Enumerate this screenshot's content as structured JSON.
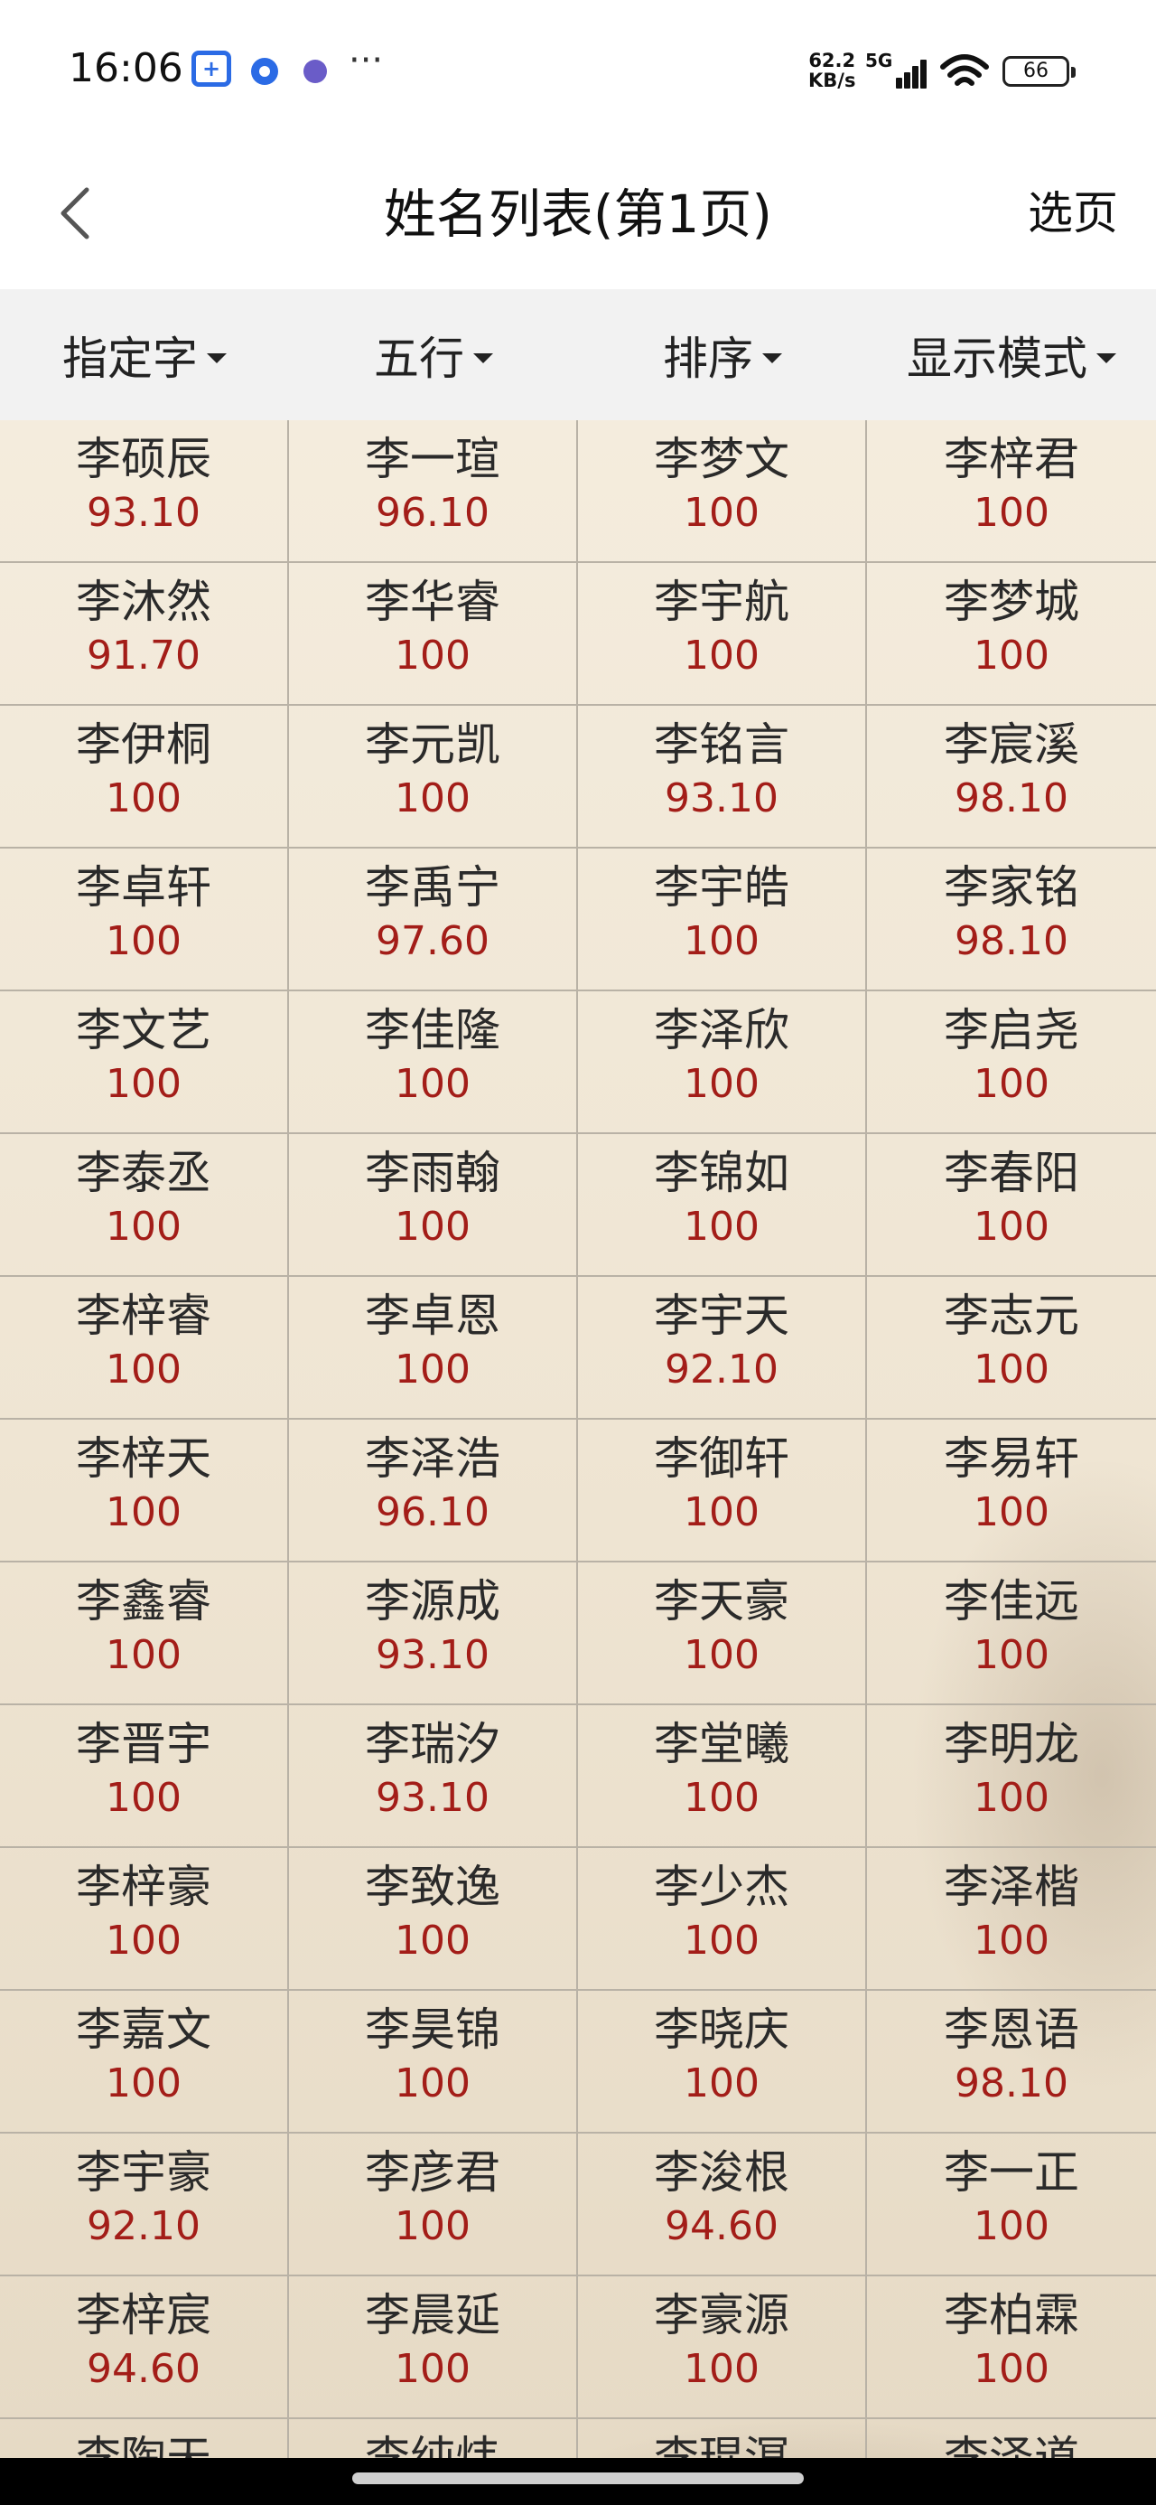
{
  "status": {
    "time": "16:06",
    "net_speed_value": "62.2",
    "net_speed_unit": "KB/s",
    "network": "5G",
    "battery": "66",
    "more": "···",
    "app_icon_text": "+"
  },
  "header": {
    "title": "姓名列表(第1页)",
    "pick_page": "选页"
  },
  "filters": [
    "指定字",
    "五行",
    "排序",
    "显示模式"
  ],
  "rows": [
    [
      {
        "name": "李硕辰",
        "score": "93.10"
      },
      {
        "name": "李一瑄",
        "score": "96.10"
      },
      {
        "name": "李梦文",
        "score": "100"
      },
      {
        "name": "李梓君",
        "score": "100"
      }
    ],
    [
      {
        "name": "李沐然",
        "score": "91.70"
      },
      {
        "name": "李华睿",
        "score": "100"
      },
      {
        "name": "李宇航",
        "score": "100"
      },
      {
        "name": "李梦城",
        "score": "100"
      }
    ],
    [
      {
        "name": "李伊桐",
        "score": "100"
      },
      {
        "name": "李元凯",
        "score": "100"
      },
      {
        "name": "李铭言",
        "score": "93.10"
      },
      {
        "name": "李宸溪",
        "score": "98.10"
      }
    ],
    [
      {
        "name": "李卓轩",
        "score": "100"
      },
      {
        "name": "李禹宁",
        "score": "97.60"
      },
      {
        "name": "李宇皓",
        "score": "100"
      },
      {
        "name": "李家铭",
        "score": "98.10"
      }
    ],
    [
      {
        "name": "李文艺",
        "score": "100"
      },
      {
        "name": "李佳隆",
        "score": "100"
      },
      {
        "name": "李泽欣",
        "score": "100"
      },
      {
        "name": "李启尧",
        "score": "100"
      }
    ],
    [
      {
        "name": "李泰丞",
        "score": "100"
      },
      {
        "name": "李雨翰",
        "score": "100"
      },
      {
        "name": "李锦如",
        "score": "100"
      },
      {
        "name": "李春阳",
        "score": "100"
      }
    ],
    [
      {
        "name": "李梓睿",
        "score": "100"
      },
      {
        "name": "李卓恩",
        "score": "100"
      },
      {
        "name": "李宇天",
        "score": "92.10"
      },
      {
        "name": "李志元",
        "score": "100"
      }
    ],
    [
      {
        "name": "李梓天",
        "score": "100"
      },
      {
        "name": "李泽浩",
        "score": "96.10"
      },
      {
        "name": "李御轩",
        "score": "100"
      },
      {
        "name": "李易轩",
        "score": "100"
      }
    ],
    [
      {
        "name": "李鑫睿",
        "score": "100"
      },
      {
        "name": "李源成",
        "score": "93.10"
      },
      {
        "name": "李天豪",
        "score": "100"
      },
      {
        "name": "李佳远",
        "score": "100"
      }
    ],
    [
      {
        "name": "李晋宇",
        "score": "100"
      },
      {
        "name": "李瑞汐",
        "score": "93.10"
      },
      {
        "name": "李堂曦",
        "score": "100"
      },
      {
        "name": "李明龙",
        "score": "100"
      }
    ],
    [
      {
        "name": "李梓豪",
        "score": "100"
      },
      {
        "name": "李致逸",
        "score": "100"
      },
      {
        "name": "李少杰",
        "score": "100"
      },
      {
        "name": "李泽楷",
        "score": "100"
      }
    ],
    [
      {
        "name": "李嘉文",
        "score": "100"
      },
      {
        "name": "李昊锦",
        "score": "100"
      },
      {
        "name": "李晓庆",
        "score": "100"
      },
      {
        "name": "李恩语",
        "score": "98.10"
      }
    ],
    [
      {
        "name": "李宇豪",
        "score": "92.10"
      },
      {
        "name": "李彦君",
        "score": "100"
      },
      {
        "name": "李浚根",
        "score": "94.60"
      },
      {
        "name": "李一正",
        "score": "100"
      }
    ],
    [
      {
        "name": "李梓宸",
        "score": "94.60"
      },
      {
        "name": "李晨延",
        "score": "100"
      },
      {
        "name": "李豪源",
        "score": "100"
      },
      {
        "name": "李柏霖",
        "score": "100"
      }
    ],
    [
      {
        "name": "李陶天",
        "score": ""
      },
      {
        "name": "李纯炜",
        "score": ""
      },
      {
        "name": "李琨溟",
        "score": ""
      },
      {
        "name": "李泽道",
        "score": ""
      }
    ]
  ]
}
